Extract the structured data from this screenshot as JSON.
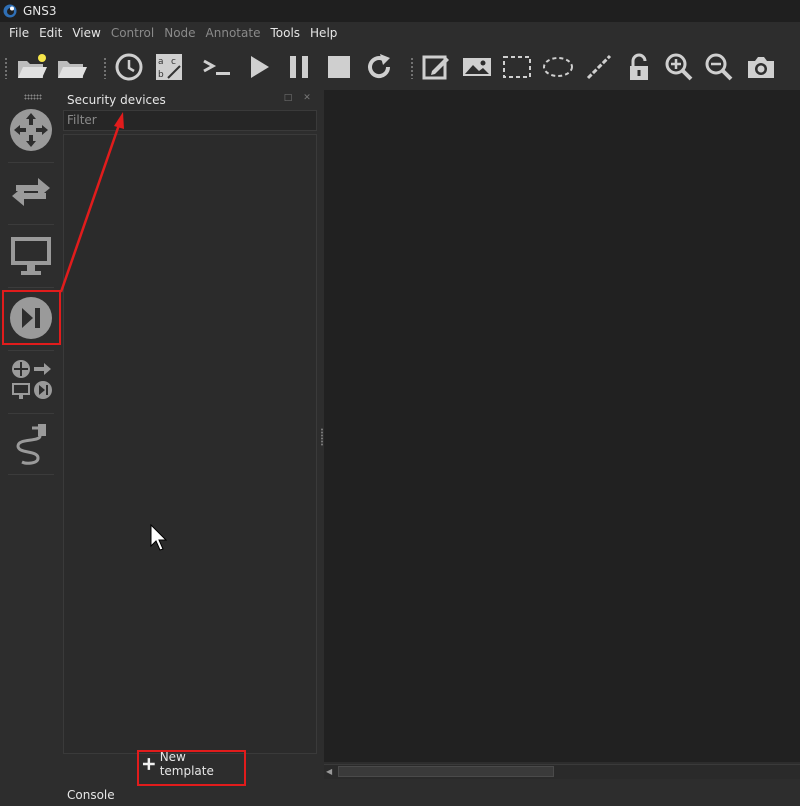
{
  "window": {
    "title": "GNS3"
  },
  "menubar": {
    "items": [
      {
        "label": "File",
        "enabled": true
      },
      {
        "label": "Edit",
        "enabled": true
      },
      {
        "label": "View",
        "enabled": true
      },
      {
        "label": "Control",
        "enabled": false
      },
      {
        "label": "Node",
        "enabled": false
      },
      {
        "label": "Annotate",
        "enabled": false
      },
      {
        "label": "Tools",
        "enabled": true
      },
      {
        "label": "Help",
        "enabled": true
      }
    ]
  },
  "toolbar": {
    "buttons": [
      "open-project-icon",
      "open-folder-icon",
      "snapshot-clock-icon",
      "abc-icon",
      "console-icon",
      "play-icon",
      "pause-icon",
      "stop-icon",
      "reload-icon",
      "note-edit-icon",
      "image-icon",
      "rectangle-icon",
      "ellipse-icon",
      "line-icon",
      "lock-icon",
      "zoom-in-icon",
      "zoom-out-icon",
      "screenshot-icon"
    ]
  },
  "dock": {
    "buttons": [
      "routers-icon",
      "switches-icon",
      "end-devices-icon",
      "security-devices-icon",
      "all-devices-icon",
      "add-link-icon"
    ],
    "active": "security-devices-icon"
  },
  "panel": {
    "title": "Security devices",
    "filter_placeholder": "Filter",
    "new_template_label": "New template"
  },
  "console": {
    "label": "Console"
  },
  "colors": {
    "highlight": "#e11c1c",
    "canvas": "#212121",
    "background": "#2d2d2d"
  }
}
